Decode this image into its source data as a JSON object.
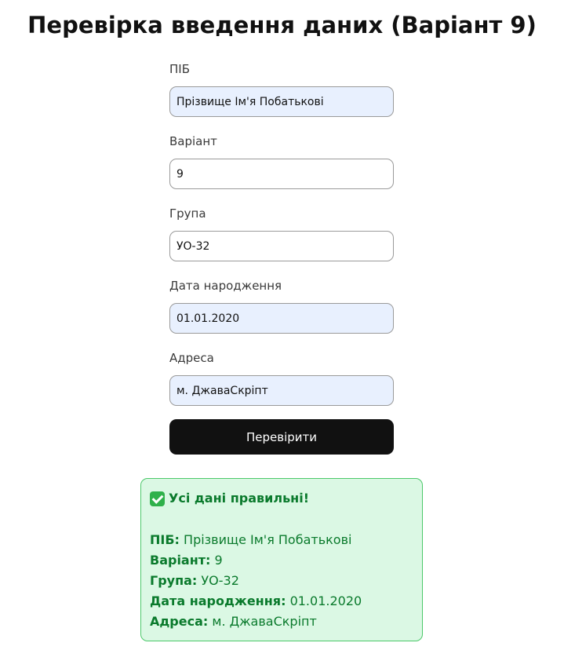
{
  "title": "Перевірка введення даних (Варіант 9)",
  "form": {
    "fields": [
      {
        "label": "ПІБ",
        "value": "Прізвище Ім'я Побатькові",
        "autofilled": true
      },
      {
        "label": "Варіант",
        "value": "9",
        "autofilled": false
      },
      {
        "label": "Група",
        "value": "УО-32",
        "autofilled": false
      },
      {
        "label": "Дата народження",
        "value": "01.01.2020",
        "autofilled": true
      },
      {
        "label": "Адреса",
        "value": "м. ДжаваСкріпт",
        "autofilled": true
      }
    ],
    "submit_label": "Перевірити"
  },
  "result": {
    "icon": "check-mark-icon",
    "heading": "Усі дані правильні!",
    "lines": [
      {
        "key": "ПІБ:",
        "value": "Прізвище Ім'я Побатькові"
      },
      {
        "key": "Варіант:",
        "value": "9"
      },
      {
        "key": "Група:",
        "value": "УО-32"
      },
      {
        "key": "Дата народження:",
        "value": "01.01.2020"
      },
      {
        "key": "Адреса:",
        "value": "м. ДжаваСкріпт"
      }
    ]
  },
  "colors": {
    "button_bg": "#111111",
    "autofill_bg": "#e8f0fe",
    "success_bg": "#dbf8e4",
    "success_border": "#4cc86a",
    "success_text": "#0a7a2c"
  }
}
